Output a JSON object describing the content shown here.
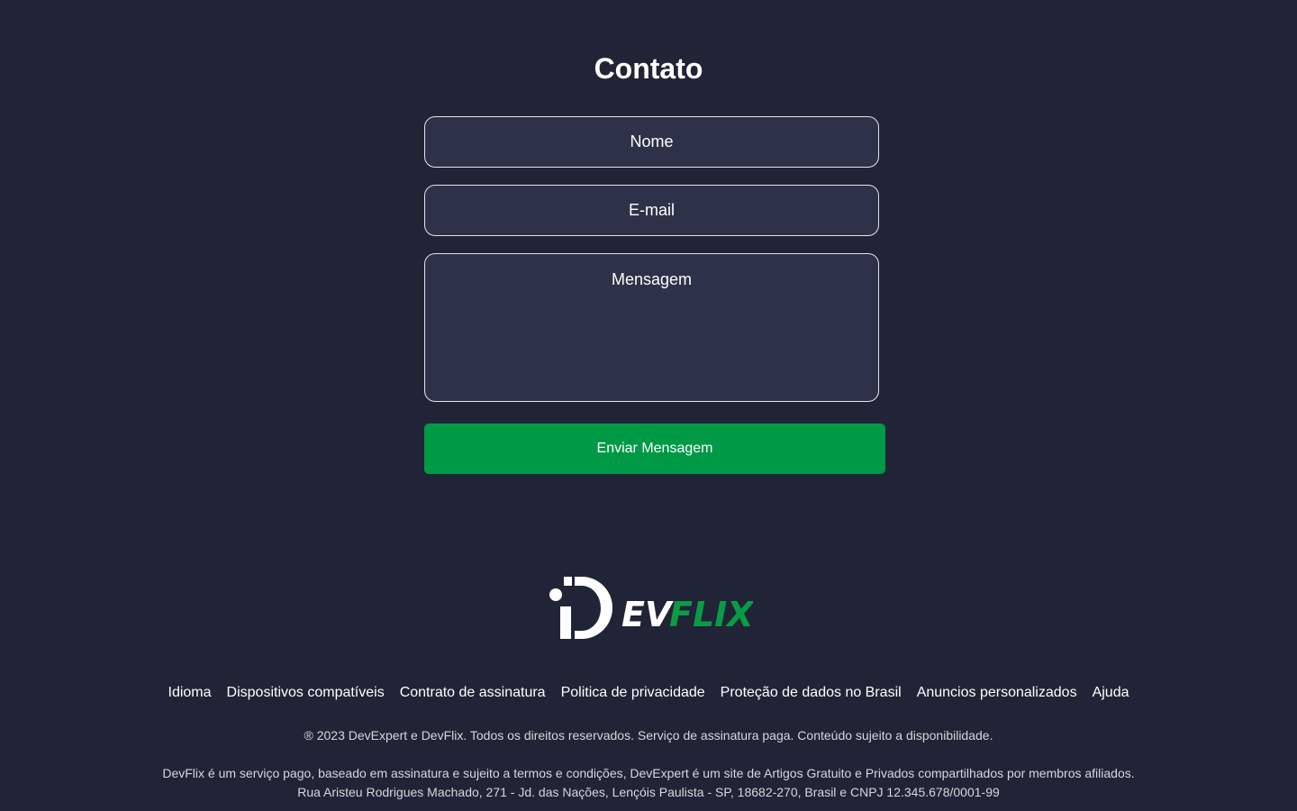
{
  "contact": {
    "title": "Contato",
    "name_placeholder": "Nome",
    "email_placeholder": "E-mail",
    "message_placeholder": "Mensagem",
    "submit_label": "Enviar Mensagem"
  },
  "logo": {
    "text_white": "EV",
    "text_green": "FLIX",
    "colors": {
      "white": "#ffffff",
      "green": "#0a9b47"
    }
  },
  "footer": {
    "links": [
      {
        "label": "Idioma"
      },
      {
        "label": "Dispositivos compatíveis"
      },
      {
        "label": "Contrato de assinatura"
      },
      {
        "label": "Politica de privacidade"
      },
      {
        "label": "Proteção de dados no Brasil"
      },
      {
        "label": "Anuncios personalizados"
      },
      {
        "label": "Ajuda"
      }
    ],
    "copyright": "® 2023 DevExpert e DevFlix. Todos os direitos reservados. Serviço de assinatura paga. Conteúdo sujeito a disponibilidade.",
    "disclaimer_line1": "DevFlix é um serviço pago, baseado em assinatura e sujeito a termos e condições, DevExpert é um site de Artigos Gratuito e Privados compartilhados por membros afiliados.",
    "disclaimer_line2": "Rua Aristeu Rodrigues Machado, 271 - Jd. das Nações, Lençóis Paulista - SP, 18682-270, Brasil e CNPJ 12.345.678/0001-99"
  },
  "colors": {
    "background": "#212436",
    "field_background": "#2d3248",
    "button": "#009a47"
  }
}
